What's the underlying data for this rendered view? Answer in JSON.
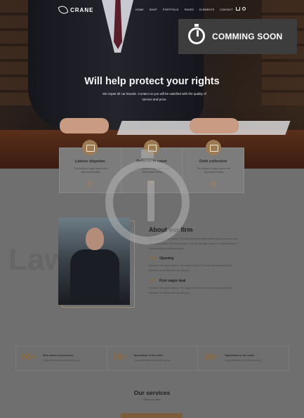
{
  "header": {
    "brand": "CRANE",
    "menu": [
      "HOME",
      "SHOP",
      "PORTFOLIO",
      "PAGES",
      "ELEMENTS",
      "CONTACT"
    ]
  },
  "badge": {
    "label": "COMMING SOON",
    "icon": "stopwatch-icon"
  },
  "hero": {
    "title": "Will help protect your rights",
    "subtitle": "We repair all car brands. Contact us you will be satisfied with the quality of service and price."
  },
  "cards": [
    {
      "title": "Labour disputes",
      "text": "The buying of large screen has skyrocketed lately",
      "icon": "briefcase-icon"
    },
    {
      "title": "Defense in court",
      "text": "The buying of large screen has skyrocketed lately",
      "icon": "gavel-icon"
    },
    {
      "title": "Debt collection",
      "text": "The buying of large screen has skyrocketed lately",
      "icon": "money-icon"
    }
  ],
  "about": {
    "bg_word": "Law",
    "title": "About our firm",
    "text": "The buying of large screen TVs has absolutely skyrocketed lately. It seems that with good reason. The large screen TVs are the right thing for a diehard fans of old that look up half your house.",
    "milestones": [
      {
        "year": "1982",
        "title": "Opening",
        "text": "It seems with good reason. The large screen TVs come along way from all diehards of old that look up half your."
      },
      {
        "year": "1997",
        "title": "First major deal",
        "text": "It seems with good reason. The large screen TVs come along way from all diehards of old that look up half your."
      }
    ]
  },
  "stats": [
    {
      "num": "90+",
      "title": "Won cases & processes",
      "text": "Long diehards of old that look up"
    },
    {
      "num": "70+",
      "title": "Specialists in the clinic",
      "text": "Long diehards of old that look up"
    },
    {
      "num": "50+",
      "title": "Specialists in the clinic",
      "text": "Long diehards of old that look up"
    }
  ],
  "services": {
    "title": "Our services",
    "subtitle": "What we offer"
  }
}
